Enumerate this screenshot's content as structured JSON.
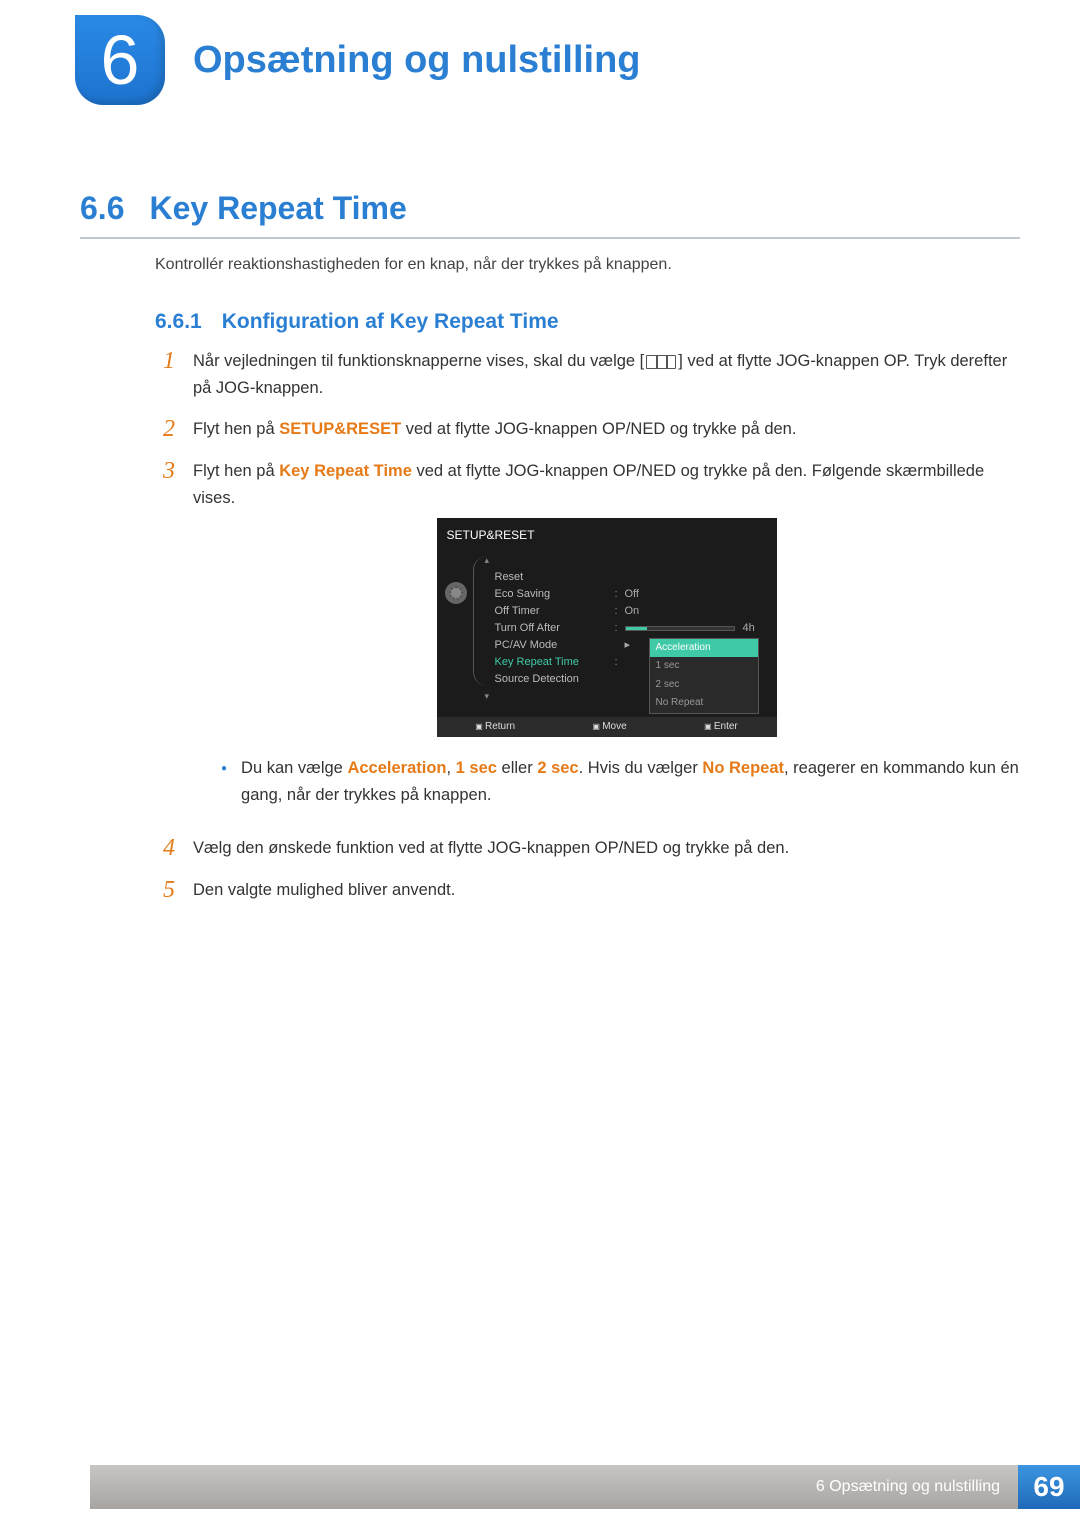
{
  "chapter": {
    "number": "6",
    "title": "Opsætning og nulstilling"
  },
  "section": {
    "number": "6.6",
    "title": "Key Repeat Time"
  },
  "intro": "Kontrollér reaktionshastigheden for en knap, når der trykkes på knappen.",
  "subsection": {
    "number": "6.6.1",
    "title": "Konfiguration af Key Repeat Time"
  },
  "steps": {
    "s1": {
      "num": "1",
      "pre": "Når vejledningen til funktionsknapperne vises, skal du vælge [",
      "iconName": "menu-icon",
      "post": "] ved at flytte JOG-knappen OP. Tryk derefter på JOG-knappen."
    },
    "s2": {
      "num": "2",
      "pre": "Flyt hen på ",
      "bold": "SETUP&RESET",
      "post": " ved at flytte JOG-knappen OP/NED og trykke på den."
    },
    "s3": {
      "num": "3",
      "pre": "Flyt hen på ",
      "bold": "Key Repeat Time",
      "post": " ved at flytte JOG-knappen OP/NED og trykke på den. Følgende skærmbillede vises."
    },
    "s4": {
      "num": "4",
      "text": "Vælg den ønskede funktion ved at flytte JOG-knappen OP/NED og trykke på den."
    },
    "s5": {
      "num": "5",
      "text": "Den valgte mulighed bliver anvendt."
    }
  },
  "bullet": {
    "t1": "Du kan vælge ",
    "b1": "Acceleration",
    "t2": ", ",
    "b2": "1 sec",
    "t3": " eller ",
    "b3": "2 sec",
    "t4": ". Hvis du vælger ",
    "b4": "No Repeat",
    "t5": ", reagerer en kommando kun én gang, når der trykkes på knappen."
  },
  "osd": {
    "title": "SETUP&RESET",
    "rows": {
      "reset": {
        "label": "Reset"
      },
      "eco": {
        "label": "Eco Saving",
        "value": "Off"
      },
      "timer": {
        "label": "Off Timer",
        "value": "On"
      },
      "turnoff": {
        "label": "Turn Off After",
        "value": "4h"
      },
      "pcav": {
        "label": "PC/AV Mode"
      },
      "krt": {
        "label": "Key Repeat Time"
      },
      "source": {
        "label": "Source Detection"
      }
    },
    "dropdown": {
      "o1": "Acceleration",
      "o2": "1 sec",
      "o3": "2 sec",
      "o4": "No Repeat"
    },
    "footer": {
      "return": "Return",
      "move": "Move",
      "enter": "Enter"
    }
  },
  "footer": {
    "crumb": "6 Opsætning og nulstilling",
    "page": "69"
  }
}
